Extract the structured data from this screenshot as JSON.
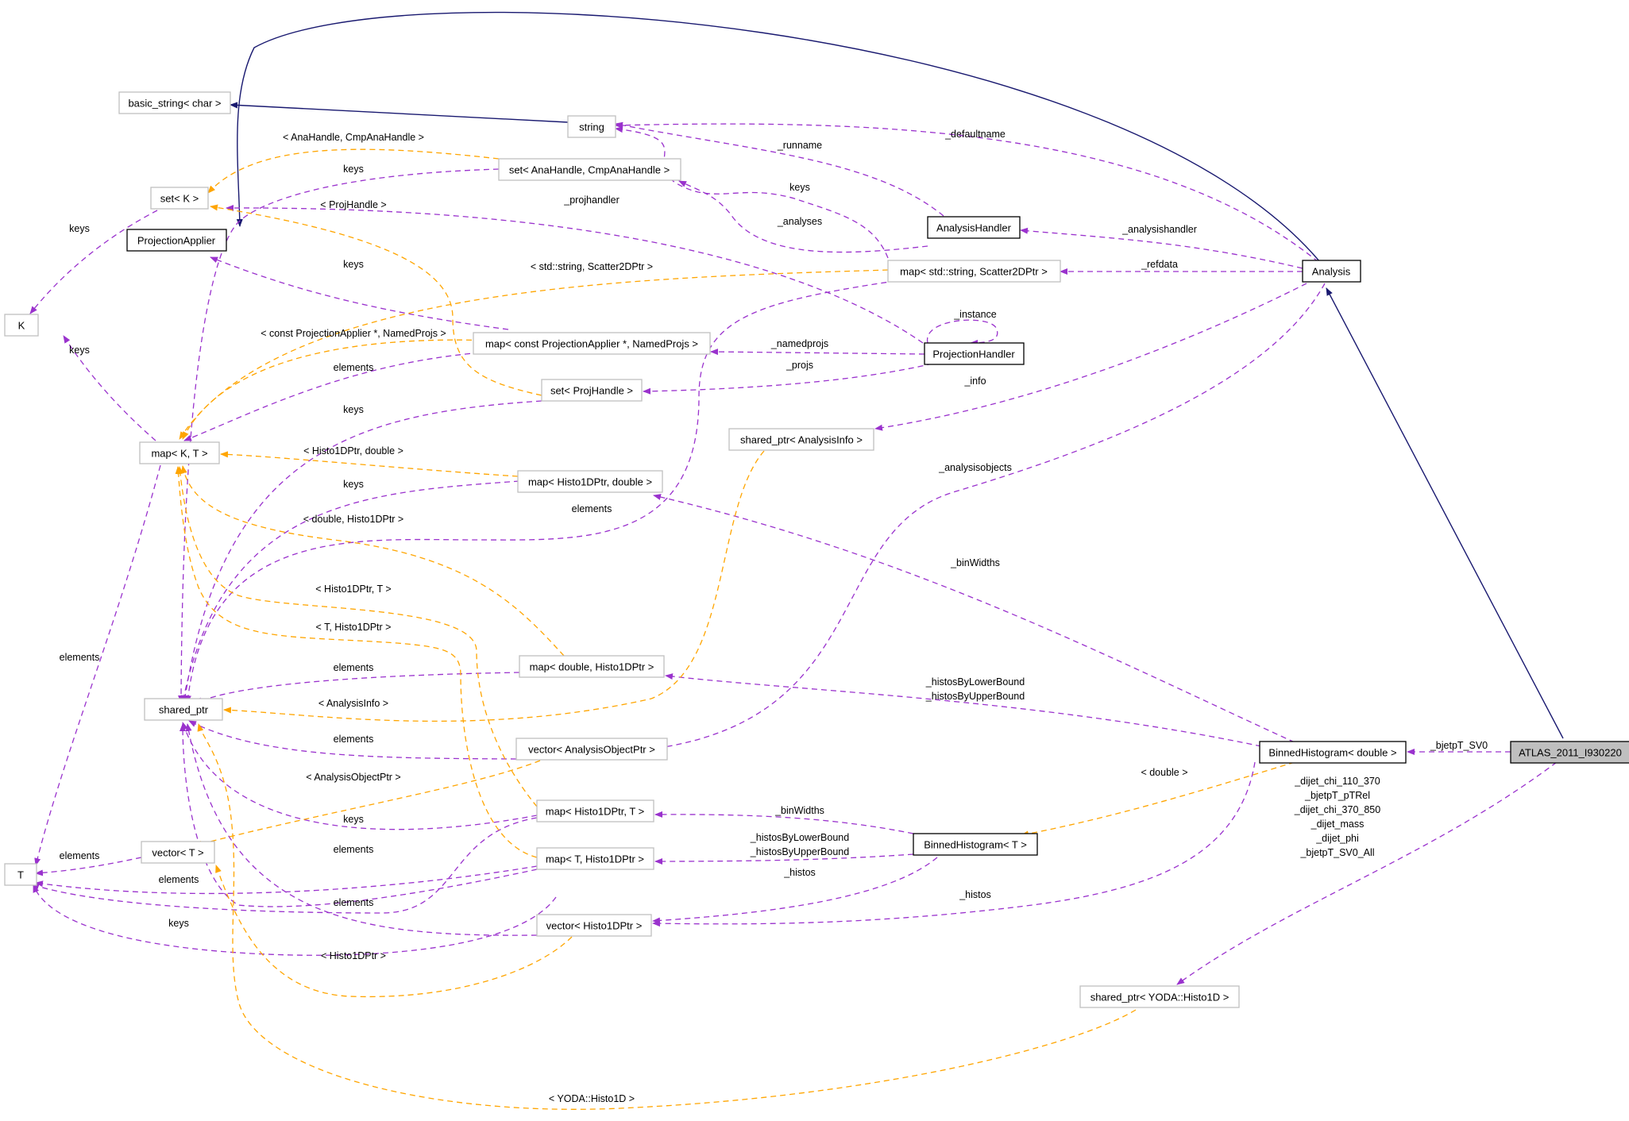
{
  "nodes": {
    "basic_string": "basic_string< char >",
    "string": "string",
    "set_anahandle": "set< AnaHandle, CmpAnaHandle >",
    "set_k": "set< K >",
    "projection_applier": "ProjectionApplier",
    "k": "K",
    "analysis_handler": "AnalysisHandler",
    "map_string_scatter": "map< std::string, Scatter2DPtr >",
    "analysis": "Analysis",
    "map_const_projapplier": "map< const ProjectionApplier *, NamedProjs >",
    "projection_handler": "ProjectionHandler",
    "set_projhandle": "set< ProjHandle >",
    "shared_ptr_analysisinfo": "shared_ptr< AnalysisInfo >",
    "map_k_t": "map< K, T >",
    "map_histo1d_double": "map< Histo1DPtr, double >",
    "map_double_histo1d": "map< double, Histo1DPtr >",
    "shared_ptr": "shared_ptr",
    "vector_analysisobject": "vector< AnalysisObjectPtr >",
    "binned_histogram_double": "BinnedHistogram< double >",
    "atlas": "ATLAS_2011_I930220",
    "map_histo1d_t": "map< Histo1DPtr, T >",
    "binned_histogram_t": "BinnedHistogram< T >",
    "vector_t": "vector< T >",
    "t": "T",
    "map_t_histo1d": "map< T, Histo1DPtr >",
    "vector_histo1d": "vector< Histo1DPtr >",
    "shared_ptr_yoda": "shared_ptr< YODA::Histo1D >"
  },
  "edge_labels": {
    "anahandle_cmp": "< AnaHandle, CmpAnaHandle >",
    "keys_setanahandle": "keys",
    "keys_setk": "keys",
    "projhandle": "< ProjHandle >",
    "projhandler": "_projhandler",
    "runname": "_runname",
    "keys_mapscatter": "keys",
    "analyses": "_analyses",
    "defaultname": "_defaultname",
    "analysishandler": "_analysishandler",
    "refdata": "_refdata",
    "keys_projapplier": "keys",
    "string_scatter": "< std::string, Scatter2DPtr >",
    "instance": "_instance",
    "const_projapplier": "< const ProjectionApplier *, NamedProjs >",
    "keys_mapkt": "keys",
    "namedprojs": "_namedprojs",
    "elements_mapconst": "elements",
    "projs": "_projs",
    "info": "_info",
    "keys_setprojhandle": "keys",
    "histo1d_double": "< Histo1DPtr, double >",
    "analysisobjects": "_analysisobjects",
    "keys_maphistodouble": "keys",
    "elements_mapscatter": "elements",
    "double_histo1d": "< double, Histo1DPtr >",
    "binwidths_top": "_binWidths",
    "histo1d_t": "< Histo1DPtr, T >",
    "t_histo1d": "< T, Histo1DPtr >",
    "elements_mapkt": "elements",
    "elements_mapdoublehisto": "elements",
    "histos_by_bound_top": [
      "_histosByLowerBound",
      "_histosByUpperBound"
    ],
    "analysisinfo": "< AnalysisInfo >",
    "bjetpt_sv0": "_bjetpT_SV0",
    "elements_vectoranalysisobject": "elements",
    "double": "< double >",
    "histos_list": [
      "_dijet_chi_110_370",
      "_bjetpT_pTRel",
      "_dijet_chi_370_850",
      "_dijet_mass",
      "_dijet_phi",
      "_bjetpT_SV0_All"
    ],
    "analysisobjectptr": "< AnalysisObjectPtr >",
    "binwidths_bottom": "_binWidths",
    "keys_maphistot": "keys",
    "histos_by_bound_bottom": [
      "_histosByLowerBound",
      "_histosByUpperBound"
    ],
    "elements_vectort": "elements",
    "elements_maphistot": "elements",
    "histos_bottom": "_histos",
    "elements_t": "elements",
    "histos_right": "_histos",
    "elements_vectorhisto": "elements",
    "keys_t": "keys",
    "histo1dptr": "< Histo1DPtr >",
    "yoda_histo1d": "< YODA::Histo1D >"
  },
  "colors": {
    "inheritance": "#191970",
    "usage": "#9a32cd",
    "template": "#ffa500",
    "node_border_grey": "#bfbfbf",
    "node_highlight": "#bfbfbf"
  }
}
